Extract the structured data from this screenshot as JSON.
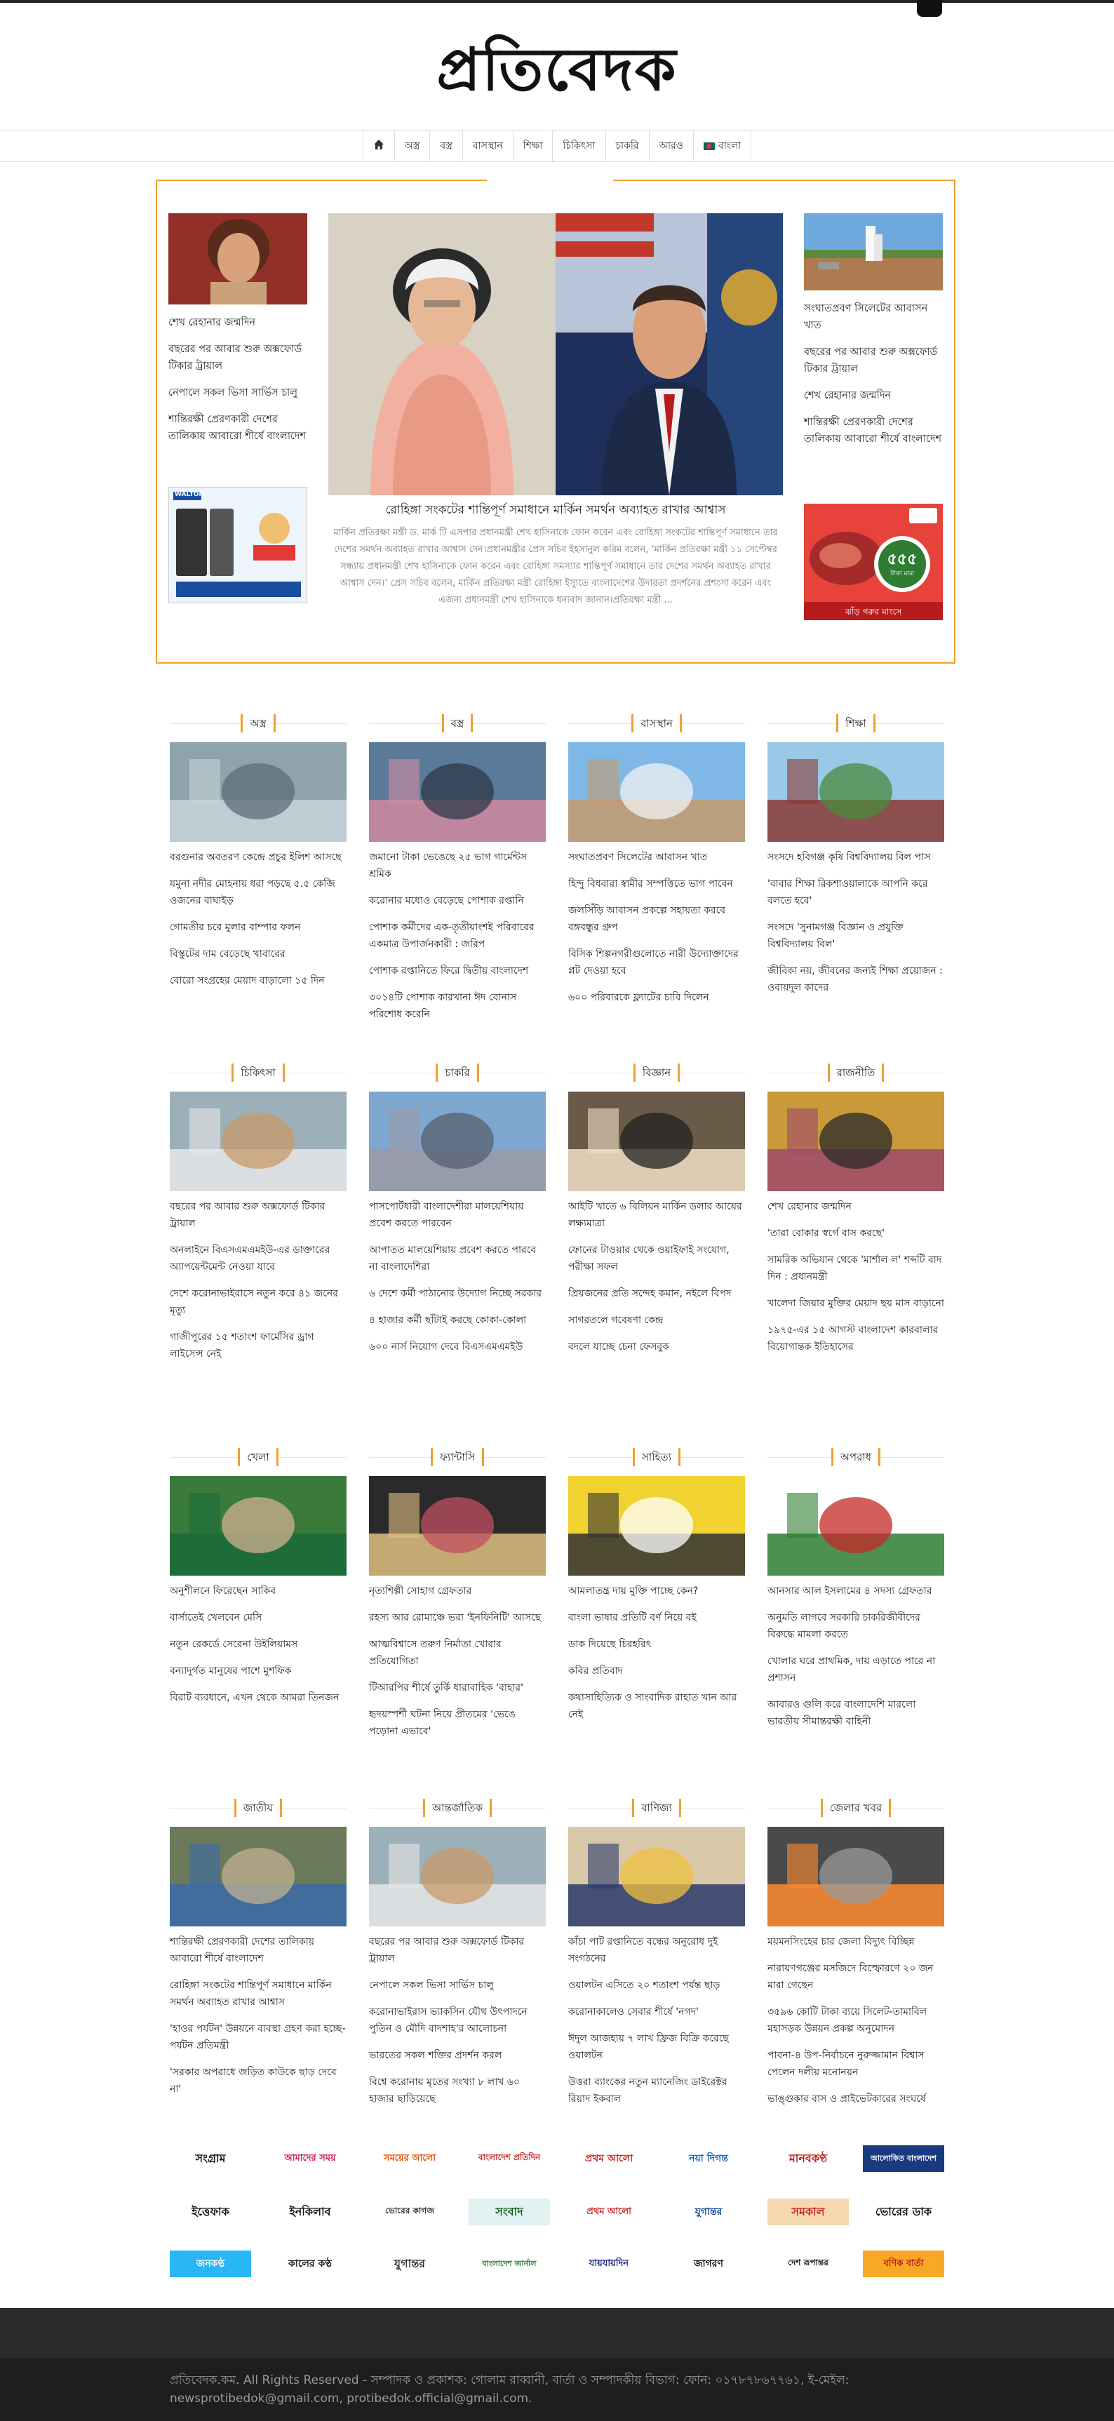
{
  "site": {
    "logo_text": "প্রতিবেদক"
  },
  "nav": {
    "home_icon": "home-icon",
    "items": [
      "অস্ত্র",
      "বস্ত্র",
      "বাসস্থান",
      "শিক্ষা",
      "চিকিৎসা",
      "চাকরি",
      "আরও",
      "বাংলা"
    ]
  },
  "featured": {
    "left": {
      "top_title": "শেখ রেহানার জন্মদিন",
      "links": [
        "বছরের পর আবার শুরু অক্সফোর্ড টিকার ট্রায়াল",
        "নেপালে সকল ভিসা সার্ভিস চালু",
        "শান্তিরক্ষী প্রেরণকারী দেশের তালিকায় আবারো শীর্ষে বাংলাদেশ"
      ],
      "ad_brand": "WALTON"
    },
    "lead": {
      "title": "রোহিঙ্গা সংকটের শান্তিপূর্ণ সমাধানে মার্কিন সমর্থন অব্যাহত রাখার আশ্বাস",
      "excerpt": "মার্কিন প্রতিরক্ষা মন্ত্রী ড. মার্ক টি এসপার প্রধানমন্ত্রী শেখ হাসিনাকে ফোন করেন এবং রোহিঙ্গা সংকটের শান্তিপূর্ণ সমাধানে তার দেশের সমর্থন অব্যাহত রাখার আশ্বাস দেন।প্রধানমন্ত্রীর প্রেস সচিব ইহসানুল করিম বলেন, ‘মার্কিন প্রতিরক্ষা মন্ত্রী ১১ সেপ্টেম্বর সন্ধ্যায় প্রধানমন্ত্রী শেখ হাসিনাকে ফোন করেন এবং রোহিঙ্গা সমস্যার শান্তিপূর্ণ সমাধানে তার দেশের সমর্থন অব্যাহত রাখার আশ্বাস দেন।’ প্রেস সচিব বলেন, মার্কিন প্রতিরক্ষা মন্ত্রী রোহিঙ্গা ইস্যুতে বাংলাদেশের উদারতা প্রদর্শনের প্রশংসা করেন এবং এজন্য প্রধানমন্ত্রী শেখ হাসিনাকে ধন্যবাদ জানান।প্রতিরক্ষা মন্ত্রী ..."
    },
    "right": {
      "top_title": "সংঘাতপ্রবণ সিলেটের আবাসন খাত",
      "links": [
        "বছরের পর আবার শুরু অক্সফোর্ড টিকার ট্রায়াল",
        "শেখ রেহানার জন্মদিন",
        "শান্তিরক্ষী প্রেরণকারী দেশের তালিকায় আবারো শীর্ষে বাংলাদেশ"
      ],
      "ad_price": "৫৫৫",
      "ad_unit": "টাকা মাত্র",
      "ad_caption": "ঝাঁড় গরুর মাংসে"
    }
  },
  "categories": [
    {
      "name": "অস্ত্র",
      "top": "বরগুনার অবতরণ কেন্দ্রে প্রচুর ইলিশ আসছে",
      "links": [
        "যমুনা নদীর মোহনায় ধরা পড়ছে ৫.৫ কেজি ওজনের বাঘাইড়",
        "গোমতীর চরে মুলার বাম্পার ফলন",
        "বিস্কুটের দাম বেড়েছে খাবারের",
        "বোরো সংগ্রহের মেয়াদ বাড়ালো ১৫ দিন"
      ]
    },
    {
      "name": "বস্ত্র",
      "top": "জমানো টাকা ভেঙেছে ২৫ ভাগ গার্মেন্টস শ্রমিক",
      "links": [
        "করোনার মধ্যেও বেড়েছে পোশাক রপ্তানি",
        "পোশাক কর্মীদের এক-তৃতীয়াংশই পরিবারের একমাত্র উপার্জনকারী : জরিপ",
        "পোশাক রপ্তানিতে ফিরে দ্বিতীয় বাংলাদেশ",
        "৩০১৪টি পোশাক কারখানা ঈদ বোনাস পরিশোধ করেনি"
      ]
    },
    {
      "name": "বাসস্থান",
      "top": "সংঘাতপ্রবণ সিলেটের আবাসন খাত",
      "links": [
        "হিন্দু বিধবারা স্বামীর সম্পত্তিতে ভাগ পাবেন",
        "জলসিঁড়ি আবাসন প্রকল্পে সহায়তা করবে বঙ্গবন্ধুর গ্রুপ",
        "বিসিক শিল্পনগরীগুলোতে নারী উদ্যোক্তাদের প্লট দেওয়া হবে",
        "৬০০ পরিবারকে ফ্ল্যাটের চাবি দিলেন"
      ]
    },
    {
      "name": "শিক্ষা",
      "top": "সংসদে হবিগঞ্জ কৃষি বিশ্ববিদ্যালয় বিল পাস",
      "links": [
        "'বাবার শিক্ষা রিকশাওয়ালাকে আপনি করে বলতে হবে'",
        "সংসদে 'সুনামগঞ্জ বিজ্ঞান ও প্রযুক্তি বিশ্ববিদ্যালয় বিল'",
        "জীবিকা নয়, জীবনের জন্যই শিক্ষা প্রয়োজন : ওবায়দুল কাদের"
      ]
    },
    {
      "name": "চিকিৎসা",
      "top": "বছরের পর আবার শুরু অক্সফোর্ড টিকার ট্রায়াল",
      "links": [
        "অনলাইনে বিএসএমএমইউ-এর ডাক্তারের অ্যাপয়েন্টমেন্ট নেওয়া যাবে",
        "দেশে করোনাভাইরাসে নতুন করে ৪১ জনের মৃত্যু",
        "গাজীপুরের ১৫ শতাংশ ফার্মেসির ড্রাগ লাইসেন্স নেই"
      ]
    },
    {
      "name": "চাকরি",
      "top": "পাসপোর্টধারী বাংলাদেশীরা মালয়েশিয়ায় প্রবেশ করতে পারবেন",
      "links": [
        "আপাতত মালয়েশিয়ায় প্রবেশ করতে পারবে না বাংলাদেশিরা",
        "৬ দেশে কর্মী পাঠানোর উদ্যোগ নিচ্ছে সরকার",
        "৪ হাজার কর্মী ছাঁটাই করছে কোকা-কোলা",
        "৬০০ নার্স নিয়োগ দেবে বিএসএমএমইউ"
      ]
    },
    {
      "name": "বিজ্ঞান",
      "top": "আইটি খাতে ৬ বিলিয়ন মার্কিন ডলার আয়ের লক্ষ্যমাত্রা",
      "links": [
        "ফোনের টাওয়ার থেকে ওয়াইফাই সংযোগ, পরীক্ষা সফল",
        "প্রিয়জনের প্রতি সন্দেহ কমান, নইলে বিপদ",
        "সাগরতলে গবেষণা কেন্দ্র",
        "বদলে যাচ্ছে চেনা ফেসবুক"
      ]
    },
    {
      "name": "রাজনীতি",
      "top": "শেখ রেহানার জন্মদিন",
      "links": [
        "'তারা বোকার স্বর্গে বাস করছে'",
        "সামরিক অভিযান থেকে 'মার্শাল ল' শব্দটি বাদ দিন : প্রধানমন্ত্রী",
        "খালেদা জিয়ার মুক্তির মেয়াদ ছয় মাস বাড়ানো",
        "১৯৭৫-এর ১৫ আগস্ট বাংলাদেশ কারবালার বিয়োগান্তক ইতিহাসের"
      ]
    },
    {
      "name": "খেলা",
      "top": "অনুশীলনে ফিরেছেন সাকিব",
      "links": [
        "বার্সাতেই খেলবেন মেসি",
        "নতুন রেকর্ডে সেরেনা উইলিয়ামস",
        "বন্যাদুর্গত মানুষের পাশে মুশফিক",
        "বিরাট ব্যবধানে, এখন থেকে আমরা তিনজন"
      ]
    },
    {
      "name": "ফ্যান্টাসি",
      "top": "নৃত্যশিল্পী সোহাগ গ্রেফতার",
      "links": [
        "রহস্য আর রোমাঞ্চে ভরা 'ইনফিনিটি' আসছে",
        "আত্মবিশ্বাসে তরুণ নির্মাতা খোরার প্রতিযোগিতা",
        "টিআরপির শীর্ষে তুর্কি ধারাবাহিক 'বাহার'",
        "হৃদয়স্পর্শী ঘটনা নিয়ে প্রীতমের 'ভেঙে পড়োনা এভাবে'"
      ]
    },
    {
      "name": "সাহিত্য",
      "top": "আমলাতন্ত্র দায় মুক্তি পাচ্ছে কেন?",
      "links": [
        "বাংলা ভাষার প্রতিটি বর্ণ নিয়ে বই",
        "ডাক দিয়েছে চিরহরিৎ",
        "কবির প্রতিবাদ",
        "কথাসাহিত্যিক ও সাংবাদিক রাহাত খান আর নেই"
      ]
    },
    {
      "name": "অপরাধ",
      "top": "আনসার আল ইসলামের ৪ সদস্য গ্রেফতার",
      "links": [
        "অনুমতি লাগবে সরকারি চাকরিজীবীদের বিরুদ্ধে মামলা করতে",
        "খোলার ঘরে প্রাথমিক, দায় এড়াতে পারে না প্রশাসন",
        "আবারও গুলি করে বাংলাদেশি মারলো ভারতীয় সীমান্তরক্ষী বাহিনী"
      ]
    },
    {
      "name": "জাতীয়",
      "top": "শান্তিরক্ষী প্রেরণকারী দেশের তালিকায় আবারো শীর্ষে বাংলাদেশ",
      "links": [
        "রোহিঙ্গা সংকটের শান্তিপূর্ণ সমাধানে মার্কিন সমর্থন অব্যাহত রাখার আশ্বাস",
        "'হাওর পর্যটন' উন্নয়নে ব্যবস্থা গ্রহণ করা হচ্ছে- পর্যটন প্রতিমন্ত্রী",
        "'সরকার অপরাধে জড়িত কাউকে ছাড় দেবে না'"
      ]
    },
    {
      "name": "আন্তর্জাতিক",
      "top": "বছরের পর আবার শুরু অক্সফোর্ড টিকার ট্রায়াল",
      "links": [
        "নেপালে সকল ভিসা সার্ভিস চালু",
        "করোনাভাইরাস ভ্যাকসিন যৌথ উৎপাদনে পুতিন ও মৌদি বাদশাহ'র আলোচনা",
        "ভারতের সকল শক্তির প্রদর্শন করল",
        "বিশ্বে করোনায় মৃতের সংখ্যা ৮ লাখ ৬০ হাজার ছাড়িয়েছে"
      ]
    },
    {
      "name": "বাণিজ্য",
      "top": "কাঁচা পাট রপ্তানিতে বন্ধের অনুরোধ দুই সংগঠনের",
      "links": [
        "ওয়ালটন এসিতে ২০ শতাংশ পর্যন্ত ছাড়",
        "করোনাকালেও সেবার শীর্ষে 'নগদ'",
        "ঈদুল আজহায় ৭ লাখ ফ্রিজ বিক্রি করেছে ওয়ালটন",
        "উত্তরা ব্যাংকের নতুন ম্যানেজিং ডাইরেক্টর রিয়াদ ইকবাল"
      ]
    },
    {
      "name": "জেলার খবর",
      "top": "ময়মনসিংহের চার জেলা বিদ্যুৎ বিচ্ছিন্ন",
      "links": [
        "নারায়ণগঞ্জের মসজিদে বিস্ফোরণে ২০ জন মারা গেছেন",
        "৩৫৯৬ কোটি টাকা ব্যয়ে সিলেট-তামাবিল মহাসড়ক উন্নয়ন প্রকল্প অনুমোদন",
        "পাবনা-৪ উপ-নির্বাচনে নুরুজ্জামান বিশ্বাস পেলেন দলীয় মনোনয়ন",
        "ভাঙ্গুকার বাস ও প্রাইভেটকারের সংঘর্ষে"
      ]
    }
  ],
  "newspapers": [
    [
      "সংগ্রাম",
      "আমাদের সময়",
      "সময়ের আলো",
      "বাংলাদেশ প্রতিদিন",
      "প্রথম আলো",
      "নয়া দিগন্ত",
      "মানবকণ্ঠ",
      "আলোকিত বাংলাদেশ"
    ],
    [
      "ইত্তেফাক",
      "ইনকিলাব",
      "ভোরের কাগজ",
      "সংবাদ",
      "প্রথম আলো",
      "যুগান্তর",
      "সমকাল",
      "ভোরের ডাক"
    ],
    [
      "জনকণ্ঠ",
      "কালের কণ্ঠ",
      "যুগান্তর",
      "বাংলাদেশ জার্নাল",
      "যায়যায়দিন",
      "জাগরণ",
      "দেশ রূপান্তর",
      "বণিক বার্তা"
    ]
  ],
  "footer": {
    "text": "প্রতিবেদক.কম. All Rights Reserved - সম্পাদক ও প্রকাশক: গোলাম রাব্বানী, বার্তা ও সম্পাদকীয় বিভাগ: ফোন: ০১৭৮৭৮৬৭৭৬১, ই-মেইল: newsprotibedok@gmail.com, protibedok.official@gmail.com."
  },
  "colors": {
    "accent": "#f0a030",
    "footer_bg": "#1e1e1e"
  }
}
